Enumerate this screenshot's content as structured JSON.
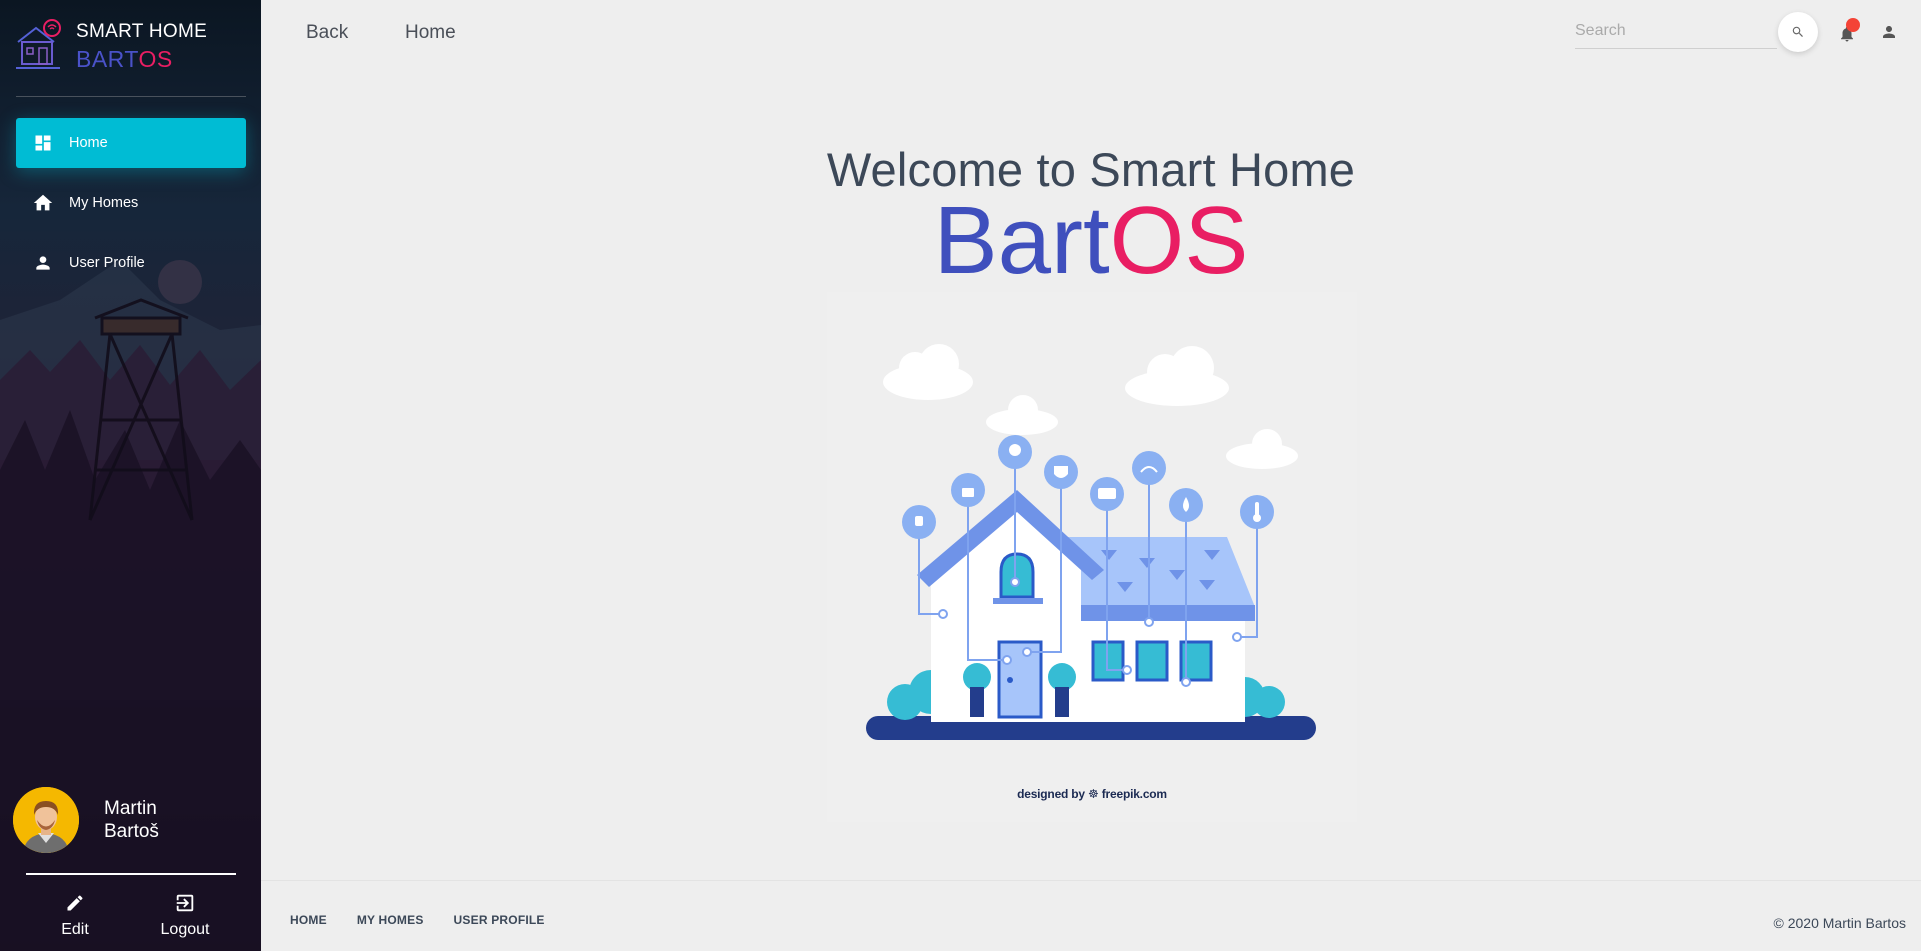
{
  "brand": {
    "title": "SMART HOME",
    "name_part1": "BART",
    "name_part2": "OS",
    "logo_icon": "smart-house-logo-icon"
  },
  "sidebar": {
    "items": [
      {
        "label": "Home",
        "icon": "dashboard-icon",
        "active": true
      },
      {
        "label": "My Homes",
        "icon": "home-icon",
        "active": false
      },
      {
        "label": "User Profile",
        "icon": "person-icon",
        "active": false
      }
    ],
    "user": {
      "first_name": "Martin",
      "last_name": "Bartoš",
      "avatar_icon": "avatar-icon"
    },
    "actions": {
      "edit_label": "Edit",
      "logout_label": "Logout"
    }
  },
  "topbar": {
    "back_label": "Back",
    "home_label": "Home",
    "search_placeholder": "Search",
    "search_value": ""
  },
  "main": {
    "welcome": "Welcome to Smart Home",
    "brand_part1": "Bart",
    "brand_part2": "OS",
    "illustration_credit": "designed by ☸ freepik.com"
  },
  "footer": {
    "links": [
      "HOME",
      "MY HOMES",
      "USER PROFILE"
    ],
    "copyright": "© 2020 Martin Bartos"
  },
  "colors": {
    "accent": "#00bcd4",
    "brand_blue": "#3f4fbd",
    "brand_pink": "#e91e63",
    "notification": "#f44336"
  }
}
